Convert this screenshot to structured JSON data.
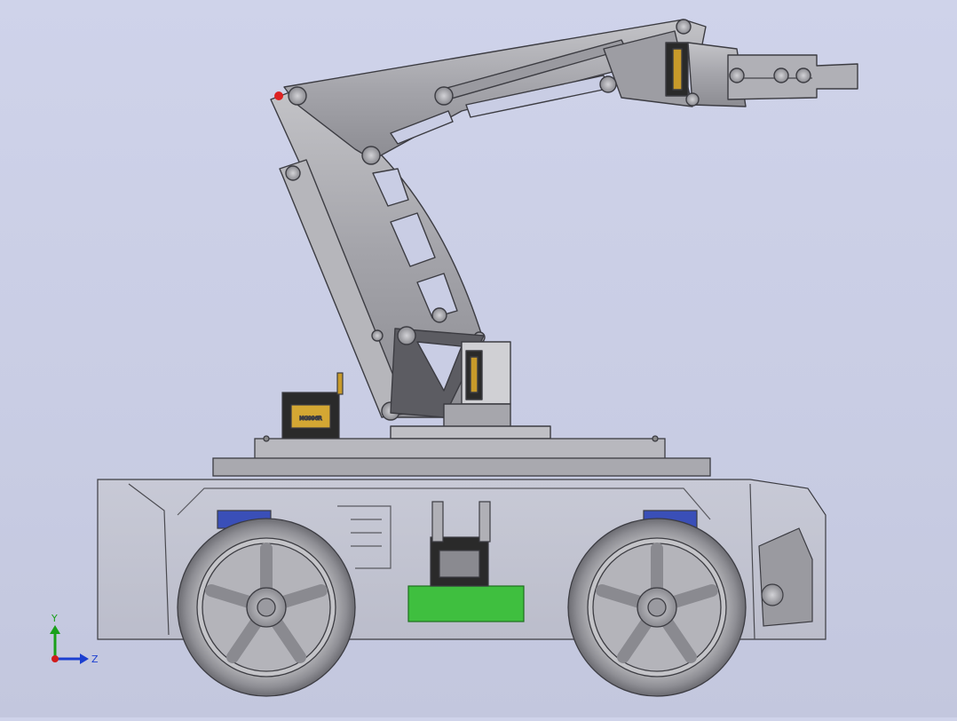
{
  "viewport": {
    "background_top": "#cfd3ea",
    "background_bottom": "#c3c7de"
  },
  "model": {
    "view": "side",
    "servo_label_1": "SERVO",
    "servo_label_2": "MG996R"
  },
  "triad": {
    "y_label": "Y",
    "z_label": "Z",
    "y_color": "#1aa01a",
    "z_color": "#1c3fd0",
    "x_color": "#d01c1c"
  },
  "colors": {
    "metal": "#a8a8ad",
    "metal_dark": "#5c5c62",
    "tire": "#9a9a9e",
    "pcb_green": "#3fbf3f",
    "copper": "#b86a4a",
    "blue_part": "#3a4fb8",
    "servo_black": "#2a2a2a"
  }
}
